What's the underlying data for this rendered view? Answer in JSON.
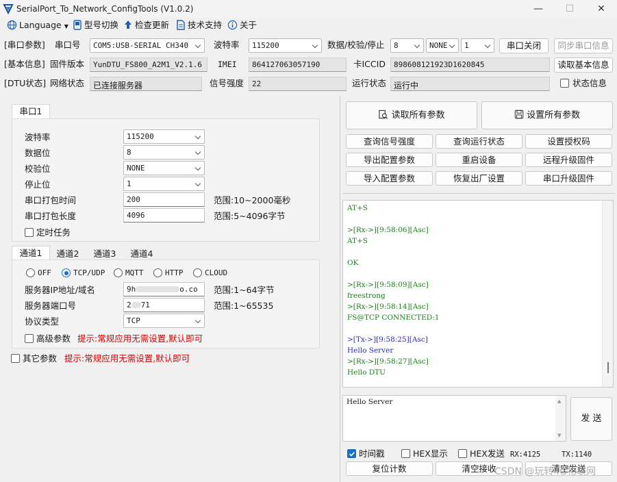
{
  "window": {
    "title": "SerialPort_To_Network_ConfigTools (V1.0.2)",
    "minimize": "—",
    "maximize": "☐",
    "close": "✕"
  },
  "menu": {
    "language": "Language",
    "model_switch": "型号切换",
    "check_update": "检查更新",
    "tech_support": "技术支持",
    "about": "关于"
  },
  "serial_params": {
    "section": "[串口参数]",
    "port_label": "串口号",
    "port_value": "COM5:USB-SERIAL CH340",
    "baud_label": "波特率",
    "baud_value": "115200",
    "dps_label": "数据/校验/停止",
    "data_bits": "8",
    "parity": "NONE",
    "stop_bits": "1",
    "close_port_button": "串口关闭",
    "sync_button": "同步串口信息"
  },
  "basic_info": {
    "section": "[基本信息]",
    "fw_label": "固件版本",
    "fw_value": "YunDTU_FS800_A2M1_V2.1.6",
    "imei_label": "IMEI",
    "imei_value": "864127063057190",
    "iccid_label": "卡ICCID",
    "iccid_value": "898608121923D1620845",
    "read_button": "读取基本信息"
  },
  "dtu_status": {
    "section": "[DTU状态]",
    "net_label": "网络状态",
    "net_value": "已连接服务器",
    "signal_label": "信号强度",
    "signal_value": "22",
    "run_label": "运行状态",
    "run_value": "运行中",
    "status_info_label": "状态信息"
  },
  "serial_tab": {
    "tab": "串口1",
    "baud_label": "波特率",
    "baud_value": "115200",
    "databits_label": "数据位",
    "databits_value": "8",
    "parity_label": "校验位",
    "parity_value": "NONE",
    "stopbits_label": "停止位",
    "stopbits_value": "1",
    "pack_time_label": "串口打包时间",
    "pack_time_value": "200",
    "pack_time_range": "范围:10~2000毫秒",
    "pack_len_label": "串口打包长度",
    "pack_len_value": "4096",
    "pack_len_range": "范围:5~4096字节",
    "timer_task_label": "定时任务"
  },
  "channel_tabs": [
    "通道1",
    "通道2",
    "通道3",
    "通道4"
  ],
  "channel": {
    "modes": [
      "OFF",
      "TCP/UDP",
      "MQTT",
      "HTTP",
      "CLOUD"
    ],
    "selected_mode": "TCP/UDP",
    "server_label": "服务器IP地址/域名",
    "server_value_start": "9h",
    "server_value_end": "o.co",
    "server_range": "范围:1~64字节",
    "port_label": "服务器端口号",
    "port_value_start": "2",
    "port_value_end": "71",
    "port_range": "范围:1~65535",
    "proto_label": "协议类型",
    "proto_value": "TCP",
    "advanced_label": "高级参数",
    "advanced_hint": "提示:常规应用无需设置,默认即可"
  },
  "other": {
    "label": "其它参数",
    "hint": "提示:常规应用无需设置,默认即可"
  },
  "actions": {
    "read_all": "读取所有参数",
    "set_all": "设置所有参数",
    "buttons": [
      "查询信号强度",
      "查询运行状态",
      "设置授权码",
      "导出配置参数",
      "重启设备",
      "远程升级固件",
      "导入配置参数",
      "恢复出厂设置",
      "串口升级固件"
    ]
  },
  "terminal": {
    "lines": [
      {
        "text": "AT+S",
        "color": "green"
      },
      {
        "text": "",
        "color": "green"
      },
      {
        "text": ">[Rx->][9:58:06][Asc]",
        "color": "green"
      },
      {
        "text": "AT+S",
        "color": "green"
      },
      {
        "text": "",
        "color": "green"
      },
      {
        "text": "OK",
        "color": "green"
      },
      {
        "text": "",
        "color": "green"
      },
      {
        "text": ">[Rx->][9:58:09][Asc]",
        "color": "green"
      },
      {
        "text": "freestrong",
        "color": "green"
      },
      {
        "text": ">[Rx->][9:58:14][Asc]",
        "color": "green"
      },
      {
        "text": "FS@TCP CONNECTED:1",
        "color": "green"
      },
      {
        "text": "",
        "color": "green"
      },
      {
        "text": ">[Tx->][9:58:25][Asc]",
        "color": "blue"
      },
      {
        "text": "Hello Server",
        "color": "blue"
      },
      {
        "text": ">[Rx->][9:58:27][Asc]",
        "color": "green"
      },
      {
        "text": "Hello DTU",
        "color": "green"
      }
    ]
  },
  "send": {
    "text": "Hello Server",
    "button": "发 送",
    "timestamp_label": "时间戳",
    "hex_display_label": "HEX显示",
    "hex_send_label": "HEX发送",
    "rx": "RX:4125",
    "tx": "TX:1140",
    "reset_count": "复位计数",
    "clear_recv": "清空接收",
    "clear_send": "清空发送"
  },
  "watermark": "CSDN @玩转4G物联网"
}
